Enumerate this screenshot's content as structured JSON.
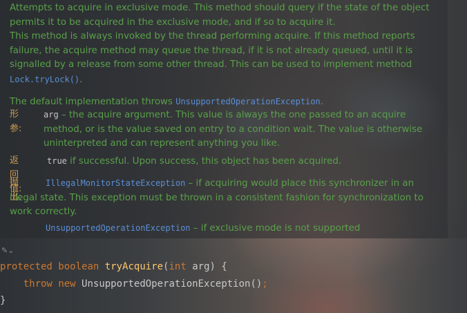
{
  "doc": {
    "para1": "Attempts to acquire in exclusive mode. This method should query if the state of the object permits it to be acquired in the exclusive mode, and if so to acquire it.",
    "para2_text": "This method is always invoked by the thread performing acquire. If this method reports failure, the acquire method may queue the thread, if it is not already queued, until it is signalled by a release from some other thread. This can be used to implement method ",
    "para2_code": "Lock.tryLock()",
    "para2_end": ".",
    "para3_text": "The default implementation throws ",
    "para3_code": "UnsupportedOperationException",
    "para3_end": "."
  },
  "params": {
    "label": "形参:",
    "name": "arg",
    "desc": " – the acquire argument. This value is always the one passed to an acquire method, or is the value saved on entry to a condition wait. The value is otherwise uninterpreted and can represent anything you like."
  },
  "returns": {
    "label": "返回值:",
    "value": "true",
    "desc": " if successful. Upon success, this object has been acquired."
  },
  "throws": {
    "label": "抛出:",
    "items": [
      {
        "exception": "IllegalMonitorStateException",
        "desc": " – if acquiring would place this synchronizer in an illegal state. This exception must be thrown in a consistent fashion for synchronization to work correctly."
      },
      {
        "exception": "UnsupportedOperationException",
        "desc": " – if exclusive mode is not supported"
      }
    ]
  },
  "code": {
    "line1": {
      "kw_protected": "protected",
      "kw_boolean": "boolean",
      "method": "tryAcquire",
      "open": "(",
      "kw_int": "int",
      "rest": " arg) {"
    },
    "line2": {
      "kw_throw": "throw",
      "kw_new": "new",
      "rest": " UnsupportedOperationException()",
      "semi": ";"
    },
    "line3": "}"
  },
  "icons": {
    "edit": "edit-toggle-icon"
  }
}
